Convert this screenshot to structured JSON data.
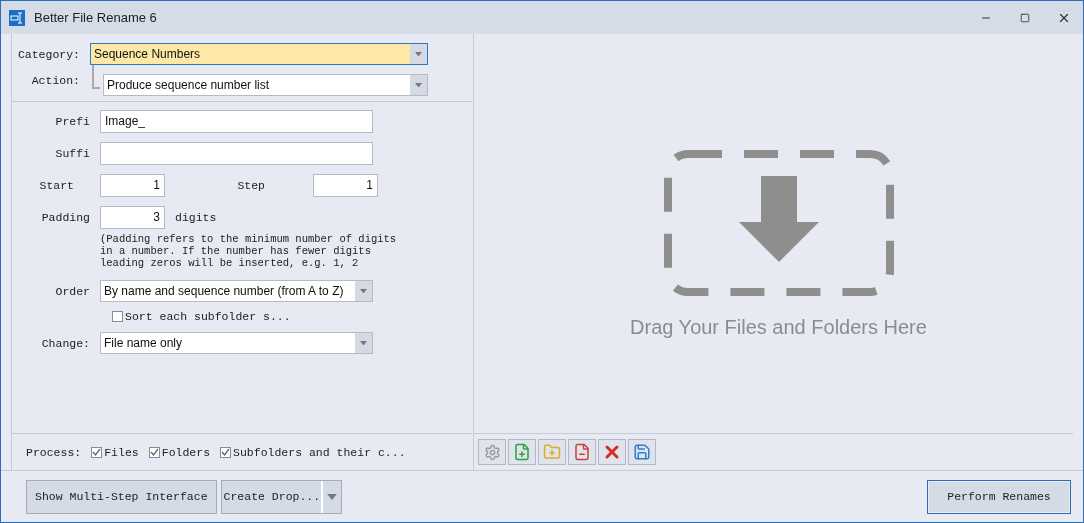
{
  "window": {
    "title": "Better File Rename 6"
  },
  "form": {
    "category": {
      "label": "Category:",
      "value": "Sequence Numbers",
      "focused": true
    },
    "action": {
      "label": "Action:",
      "value": "Produce sequence number list",
      "focused": false
    },
    "prefix": {
      "label": "Prefi",
      "value": "Image_"
    },
    "suffix": {
      "label": "Suffi"
    },
    "start": {
      "label": "Start",
      "value": "1"
    },
    "step": {
      "label": "Step",
      "value": "1"
    },
    "padding": {
      "label": "Padding",
      "value": "3",
      "unit": "digits"
    },
    "help_lines": [
      "(Padding refers to the minimum number of digits",
      "in a number. If the number has fewer digits",
      "leading zeros will be inserted, e.g. 1, 2"
    ],
    "order": {
      "label": "Order",
      "value": "By name and sequence number (from A to Z)",
      "focused": false
    },
    "sort_subfolders": {
      "label": "Sort each subfolder s...",
      "checked": false
    },
    "change": {
      "label": "Change:",
      "value": "File name only",
      "focused": false
    }
  },
  "process": {
    "label": "Process:",
    "options": [
      {
        "label": "Files",
        "checked": true
      },
      {
        "label": "Folders",
        "checked": true
      },
      {
        "label": "Subfolders and their c...",
        "checked": true
      }
    ]
  },
  "drop_zone": {
    "text": "Drag Your Files and Folders Here"
  },
  "buttons": [
    {
      "label": "Show Multi-Step Interface",
      "kind": "plain"
    },
    {
      "label": "Create Drop...",
      "kind": "split"
    },
    {
      "label": "Perform Renames",
      "kind": "default"
    }
  ]
}
